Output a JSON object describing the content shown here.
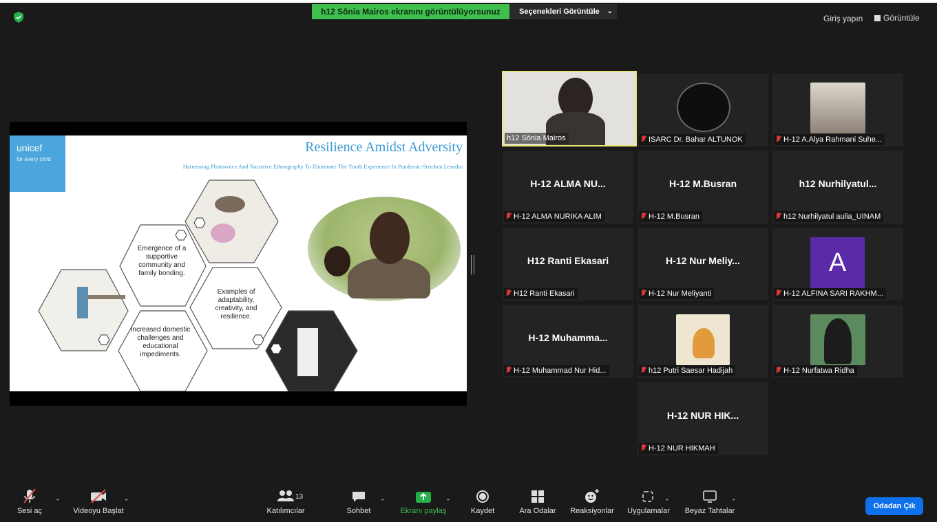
{
  "topbar": {
    "banner": "h12 Sônia Mairos ekranını görüntülüyorsunuz",
    "view_options": "Seçenekleri Görüntüle",
    "login": "Giriş yapın",
    "view": "Görüntüle"
  },
  "slide": {
    "brand": "unicef",
    "brand_tagline": "for every child",
    "title": "Resilience Amidst Adversity",
    "subtitle": "Harnessing Photovoice And Narrative Ethnography To Illuminate The Youth Experience In Pandemic-Stricken Lesotho",
    "hex1": "Emergence of a supportive community and family bonding.",
    "hex2": "Examples of adaptability, creativity, and resilience.",
    "hex3": "Increased domestic challenges and educational impediments."
  },
  "participants": [
    {
      "label": "h12 Sônia Mairos",
      "big": ""
    },
    {
      "label": "ISARC Dr. Bahar ALTUNOK",
      "big": ""
    },
    {
      "label": "H-12 A.Alya Rahmani Suhe...",
      "big": ""
    },
    {
      "label": "H-12 ALMA NURIKA ALIM",
      "big": "H-12 ALMA NU..."
    },
    {
      "label": "H-12 M.Busran",
      "big": "H-12 M.Busran"
    },
    {
      "label": "h12 Nurhilyatul aulia_UINAM",
      "big": "h12 Nurhilyatul..."
    },
    {
      "label": "H12 Ranti Ekasari",
      "big": "H12 Ranti Ekasari"
    },
    {
      "label": "H-12 Nur Meliyanti",
      "big": "H-12 Nur Meliy..."
    },
    {
      "label": "H-12 ALFINA SARI RAKHM...",
      "big": "A"
    },
    {
      "label": "H-12 Muhammad Nur Hid...",
      "big": "H-12 Muhamma..."
    },
    {
      "label": "h12 Putri Saesar Hadijah",
      "big": ""
    },
    {
      "label": "H-12 Nurfatwa Ridha",
      "big": ""
    },
    {
      "label": "H-12 NUR HIKMAH",
      "big": "H-12 NUR HIK..."
    }
  ],
  "toolbar": {
    "audio": "Sesi aç",
    "video": "Videoyu Başlat",
    "participants": "Katılımcılar",
    "participants_count": "13",
    "chat": "Sohbet",
    "share": "Ekranı paylaş",
    "record": "Kaydet",
    "breakout": "Ara Odalar",
    "reactions": "Reaksiyonlar",
    "apps": "Uygulamalar",
    "whiteboard": "Beyaz Tahtalar",
    "leave": "Odadan Çık"
  },
  "colors": {
    "share_green": "#3fbf4d",
    "leave_blue": "#0e71eb",
    "speaker_yellow": "#e8e87a",
    "muted_red": "#d93838",
    "avatar_purple": "#5b2aa8"
  }
}
